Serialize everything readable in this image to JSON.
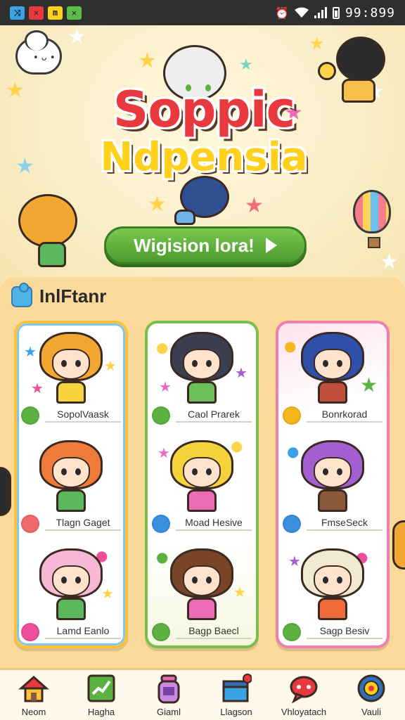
{
  "status_bar": {
    "app_badges": [
      {
        "glyph": "⤨",
        "color": "#3aa3e6"
      },
      {
        "glyph": "✕",
        "color": "#e8393e"
      },
      {
        "glyph": "m",
        "color": "#ffd11d"
      },
      {
        "glyph": "✕",
        "color": "#5dbb4a"
      }
    ],
    "clock": "99:899"
  },
  "hero": {
    "logo_line1": "Soppic",
    "logo_line2": "Ndpensia",
    "cta_label": "Wigision lora!"
  },
  "section": {
    "title": "InlFtanr"
  },
  "cards": [
    {
      "accent": "#ffc13a",
      "characters": [
        {
          "name": "SopolVaask",
          "dot_color": "#5cb240",
          "hair": "#f2a733",
          "outfit": "#f6d23c"
        },
        {
          "name": "Tlagn Gaget",
          "dot_color": "#ef6b6b",
          "hair": "#f07a3a",
          "outfit": "#5cb85c"
        },
        {
          "name": "Lamd Eanlo",
          "dot_color": "#ee4f9a",
          "hair": "#f7b8d6",
          "outfit": "#5cb85c"
        }
      ]
    },
    {
      "accent": "#7bbf4a",
      "characters": [
        {
          "name": "Caol Prarek",
          "dot_color": "#5cb240",
          "hair": "#3b3f4f",
          "outfit": "#6cc05a"
        },
        {
          "name": "Moad Hesive",
          "dot_color": "#3a8fe0",
          "hair": "#f4d23a",
          "outfit": "#ee6cb5"
        },
        {
          "name": "Bagp Baecl",
          "dot_color": "#5cb240",
          "hair": "#7a4428",
          "outfit": "#ee6cb5"
        }
      ]
    },
    {
      "accent": "#ee7fae",
      "characters": [
        {
          "name": "Bonrkorad",
          "dot_color": "#f6b620",
          "hair": "#2f4fa8",
          "outfit": "#c0503a"
        },
        {
          "name": "FmseSeck",
          "dot_color": "#3a8fe0",
          "hair": "#a35fd0",
          "outfit": "#8a5a3a"
        },
        {
          "name": "Sagp Besiv",
          "dot_color": "#5cb240",
          "hair": "#f2ead0",
          "outfit": "#f06a3a"
        }
      ]
    }
  ],
  "nav": [
    {
      "label": "Neom",
      "icon": "house-icon"
    },
    {
      "label": "Hagha",
      "icon": "chart-icon"
    },
    {
      "label": "Giaml",
      "icon": "jar-icon"
    },
    {
      "label": "Llagson",
      "icon": "box-icon"
    },
    {
      "label": "Vhloyatach",
      "icon": "chat-bubble-icon"
    },
    {
      "label": "Vauli",
      "icon": "medal-icon"
    }
  ]
}
